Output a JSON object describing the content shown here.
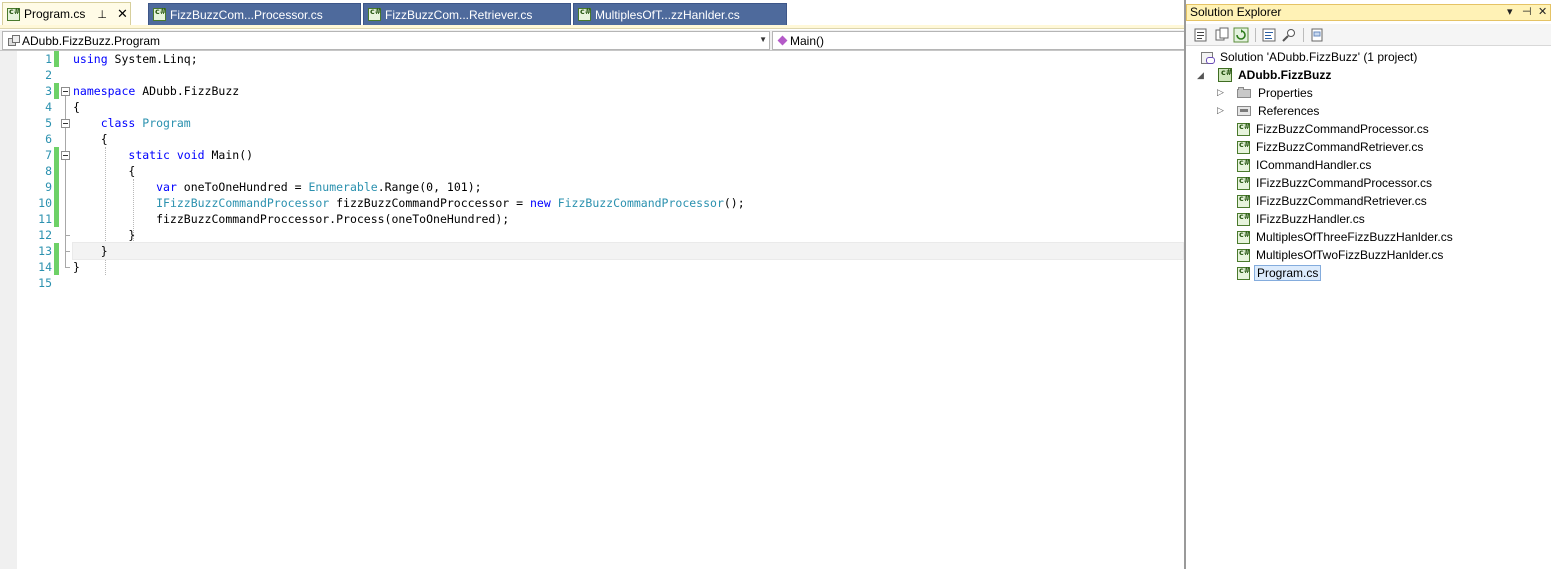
{
  "tabs": [
    {
      "label": "Program.cs",
      "active": true,
      "pin_glyph": "⊥",
      "close_glyph": "✕",
      "icon": "cs-file-icon"
    },
    {
      "label": "FizzBuzzCom...Processor.cs",
      "active": false,
      "icon": "cs-file-icon"
    },
    {
      "label": "FizzBuzzCom...Retriever.cs",
      "active": false,
      "icon": "cs-file-icon"
    },
    {
      "label": "MultiplesOfT...zzHanlder.cs",
      "active": false,
      "icon": "cs-file-icon"
    }
  ],
  "navbar": {
    "type_selector": "ADubb.FizzBuzz.Program",
    "member_selector": "Main()",
    "dropdown_glyph": "▼"
  },
  "editor": {
    "line_numbers": [
      "1",
      "2",
      "3",
      "4",
      "5",
      "6",
      "7",
      "8",
      "9",
      "10",
      "11",
      "12",
      "13",
      "14",
      "15"
    ],
    "current_line": 13,
    "modified_lines": [
      1,
      3,
      7,
      8,
      9,
      10,
      11,
      13,
      14
    ],
    "lines": [
      [
        {
          "t": "using",
          "c": "kw"
        },
        {
          "t": " System.Linq;",
          "c": "pl"
        }
      ],
      [],
      [
        {
          "t": "namespace",
          "c": "kw"
        },
        {
          "t": " ADubb.FizzBuzz",
          "c": "pl"
        }
      ],
      [
        {
          "t": "{",
          "c": "pl"
        }
      ],
      [
        {
          "t": "    ",
          "c": "pl"
        },
        {
          "t": "class",
          "c": "kw"
        },
        {
          "t": " ",
          "c": "pl"
        },
        {
          "t": "Program",
          "c": "ty"
        }
      ],
      [
        {
          "t": "    {",
          "c": "pl"
        }
      ],
      [
        {
          "t": "        ",
          "c": "pl"
        },
        {
          "t": "static",
          "c": "kw"
        },
        {
          "t": " ",
          "c": "pl"
        },
        {
          "t": "void",
          "c": "kw"
        },
        {
          "t": " Main()",
          "c": "pl"
        }
      ],
      [
        {
          "t": "        {",
          "c": "pl"
        }
      ],
      [
        {
          "t": "            ",
          "c": "pl"
        },
        {
          "t": "var",
          "c": "kw"
        },
        {
          "t": " oneToOneHundred = ",
          "c": "pl"
        },
        {
          "t": "Enumerable",
          "c": "ty"
        },
        {
          "t": ".Range(0, 101);",
          "c": "pl"
        }
      ],
      [
        {
          "t": "            ",
          "c": "pl"
        },
        {
          "t": "IFizzBuzzCommandProcessor",
          "c": "ty"
        },
        {
          "t": " fizzBuzzCommandProccessor = ",
          "c": "pl"
        },
        {
          "t": "new",
          "c": "kw"
        },
        {
          "t": " ",
          "c": "pl"
        },
        {
          "t": "FizzBuzzCommandProcessor",
          "c": "ty"
        },
        {
          "t": "();",
          "c": "pl"
        }
      ],
      [
        {
          "t": "            fizzBuzzCommandProccessor.Process(oneToOneHundred);",
          "c": "pl"
        }
      ],
      [
        {
          "t": "        }",
          "c": "pl"
        }
      ],
      [
        {
          "t": "    }",
          "c": "pl"
        }
      ],
      [
        {
          "t": "}",
          "c": "pl"
        }
      ],
      []
    ],
    "colors": {
      "keyword": "#0000ff",
      "type": "#2b91af",
      "line_number": "#2b91af",
      "change_saved": "#6ed167"
    }
  },
  "solution_explorer": {
    "title": "Solution Explorer",
    "title_buttons": [
      "▾",
      "⊣",
      "✕"
    ],
    "solution_label": "Solution 'ADubb.FizzBuzz' (1 project)",
    "project_label": "ADubb.FizzBuzz",
    "items": [
      {
        "label": "Properties",
        "icon": "folder-icon",
        "expandable": true
      },
      {
        "label": "References",
        "icon": "references-icon",
        "expandable": true
      },
      {
        "label": "FizzBuzzCommandProcessor.cs",
        "icon": "cs-file-icon"
      },
      {
        "label": "FizzBuzzCommandRetriever.cs",
        "icon": "cs-file-icon"
      },
      {
        "label": "ICommandHandler.cs",
        "icon": "cs-file-icon"
      },
      {
        "label": "IFizzBuzzCommandProcessor.cs",
        "icon": "cs-file-icon"
      },
      {
        "label": "IFizzBuzzCommandRetriever.cs",
        "icon": "cs-file-icon"
      },
      {
        "label": "IFizzBuzzHandler.cs",
        "icon": "cs-file-icon"
      },
      {
        "label": "MultiplesOfThreeFizzBuzzHanlder.cs",
        "icon": "cs-file-icon"
      },
      {
        "label": "MultiplesOfTwoFizzBuzzHanlder.cs",
        "icon": "cs-file-icon"
      },
      {
        "label": "Program.cs",
        "icon": "cs-file-icon",
        "selected": true
      }
    ]
  }
}
